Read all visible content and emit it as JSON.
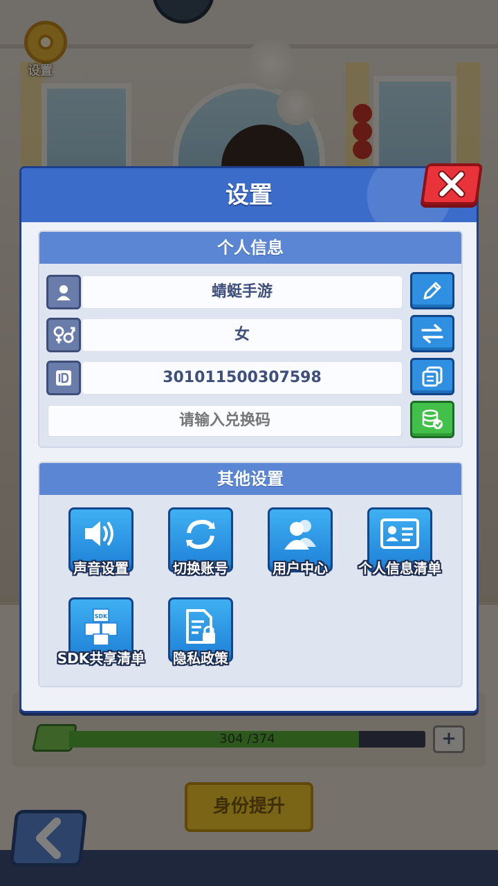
{
  "hud": {
    "settings_label": "设置",
    "progress_text": "304 /374",
    "progress_current": 304,
    "progress_max": 374,
    "plus_label": "+",
    "promote_label": "身份提升"
  },
  "dialog": {
    "title": "设置",
    "personal": {
      "header": "个人信息",
      "nickname": "蜻蜓手游",
      "gender": "女",
      "id_value": "301011500307598",
      "redeem_placeholder": "请输入兑换码"
    },
    "other": {
      "header": "其他设置",
      "items": [
        {
          "label": "声音设置",
          "icon": "speaker-icon"
        },
        {
          "label": "切换账号",
          "icon": "switch-account-icon"
        },
        {
          "label": "用户中心",
          "icon": "user-center-icon"
        },
        {
          "label": "个人信息清单",
          "icon": "id-card-icon"
        },
        {
          "label": "SDK共享清单",
          "icon": "sdk-cubes-icon"
        },
        {
          "label": "隐私政策",
          "icon": "privacy-doc-icon"
        }
      ]
    }
  },
  "colors": {
    "dialog_header": "#3c6cc9",
    "section_header": "#5b86d4",
    "action_blue": "#2f8fe0",
    "action_green": "#43c04a",
    "close_red": "#e8333a",
    "progress_green": "#5db339",
    "promote_yellow": "#f4c82b"
  }
}
